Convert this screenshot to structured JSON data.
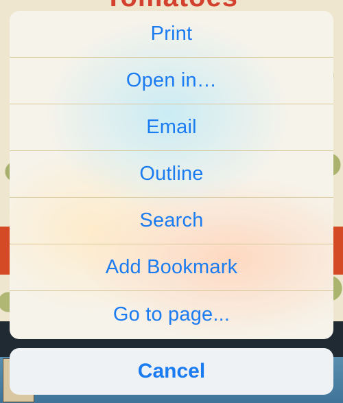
{
  "background": {
    "title": "Tomatoes"
  },
  "action_sheet": {
    "items": [
      {
        "label": "Print"
      },
      {
        "label": "Open in…"
      },
      {
        "label": "Email"
      },
      {
        "label": "Outline"
      },
      {
        "label": "Search"
      },
      {
        "label": "Add Bookmark"
      },
      {
        "label": "Go to page..."
      }
    ],
    "cancel_label": "Cancel"
  },
  "colors": {
    "accent": "#1b7bf0",
    "separator": "#d8c99c",
    "banner_red": "#d44a25"
  }
}
